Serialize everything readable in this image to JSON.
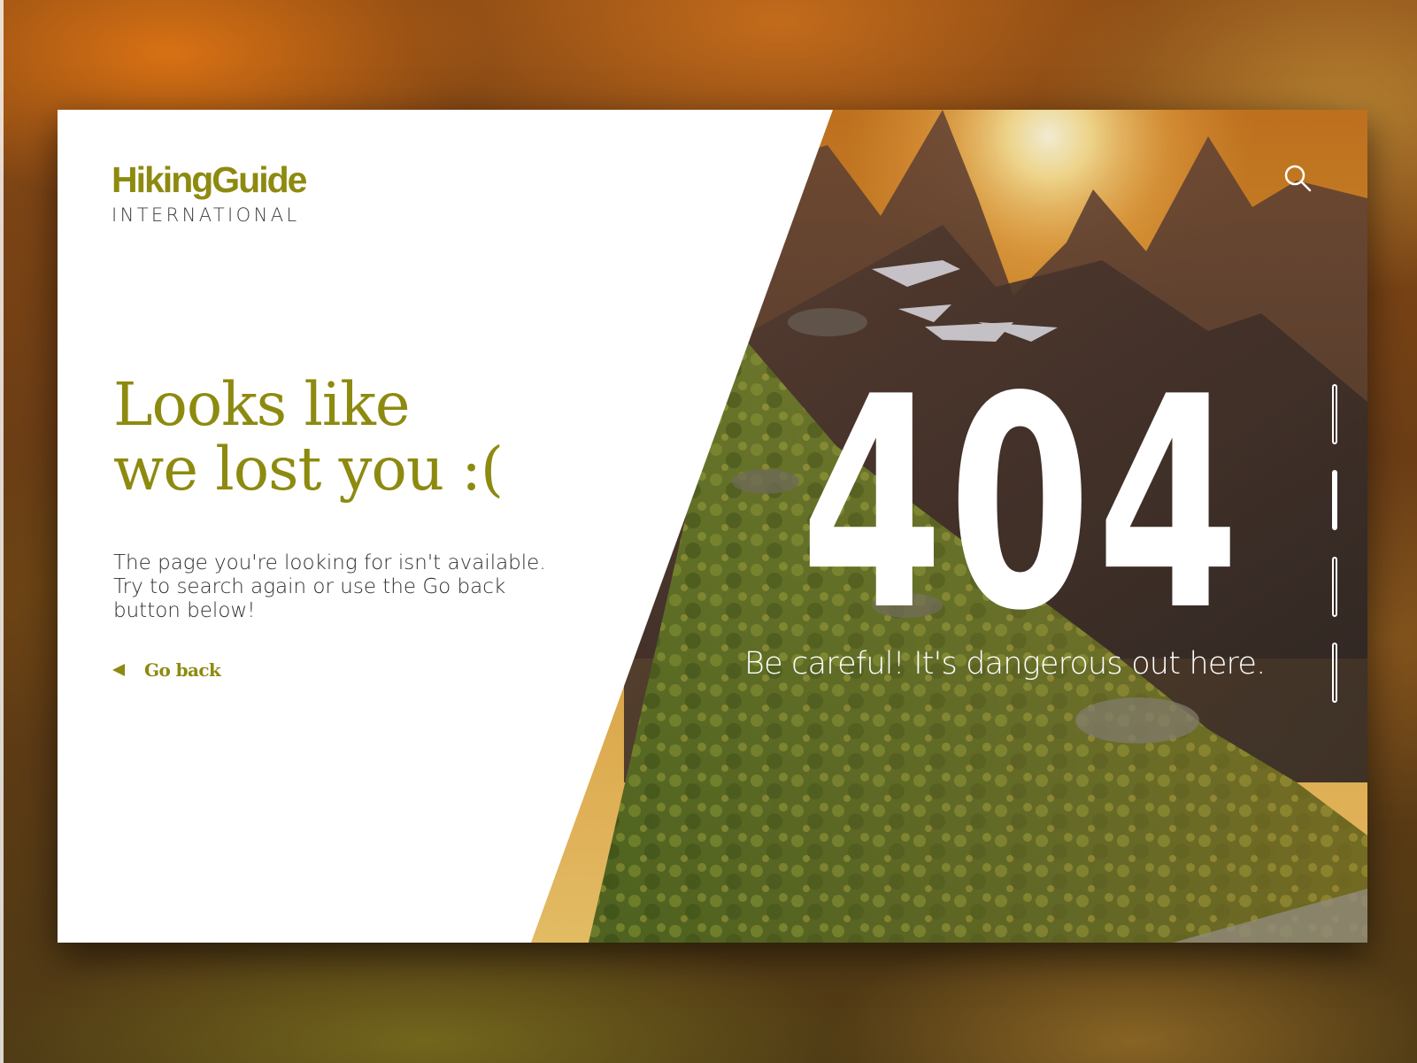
{
  "brand": {
    "name": "HikingGuide",
    "subtitle": "INTERNATIONAL"
  },
  "headline": {
    "line1": "Looks like",
    "line2": "we lost you :("
  },
  "description": {
    "line1": "The page you're looking for isn't available.",
    "line2": "Try to search again or use the Go back",
    "line3": "button below!"
  },
  "go_back": {
    "label": "Go back"
  },
  "error": {
    "code": "404",
    "tagline": "Be careful! It's dangerous out here."
  },
  "pager": {
    "count": 4,
    "active_index": 1
  },
  "icons": {
    "search": "search-icon",
    "back": "triangle-left-icon"
  },
  "colors": {
    "accent": "#8d8a10",
    "text": "#2f2f2f",
    "on_photo": "#ffffff"
  }
}
